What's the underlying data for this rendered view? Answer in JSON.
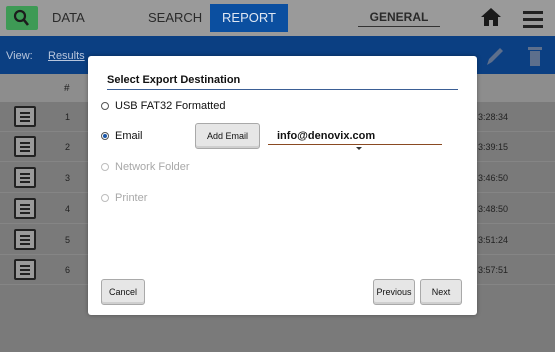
{
  "nav": {
    "data_tab": "DATA",
    "search_tab": "SEARCH",
    "report_tab": "REPORT",
    "profile_select": "GENERAL"
  },
  "viewbar": {
    "view_label": "View:",
    "view_value": "Results"
  },
  "table": {
    "header_hash": "#",
    "rows": [
      {
        "num": "1",
        "time": "3:28:34"
      },
      {
        "num": "2",
        "time": "3:39:15"
      },
      {
        "num": "3",
        "time": "3:46:50"
      },
      {
        "num": "4",
        "time": "3:48:50"
      },
      {
        "num": "5",
        "time": "3:51:24"
      },
      {
        "num": "6",
        "time": "3:57:51"
      }
    ]
  },
  "modal": {
    "title": "Select Export Destination",
    "options": [
      {
        "label": "USB FAT32 Formatted",
        "selected": false,
        "enabled": true
      },
      {
        "label": "Email",
        "selected": true,
        "enabled": true
      },
      {
        "label": "Network Folder",
        "selected": false,
        "enabled": false
      },
      {
        "label": "Printer",
        "selected": false,
        "enabled": false
      }
    ],
    "add_email_label": "Add Email",
    "email_value": "info@denovix.com",
    "cancel_label": "Cancel",
    "previous_label": "Previous",
    "next_label": "Next"
  },
  "colors": {
    "logo": "#3e9a55",
    "active_tab": "#0b4fa0",
    "viewbar": "#0b3f82"
  }
}
